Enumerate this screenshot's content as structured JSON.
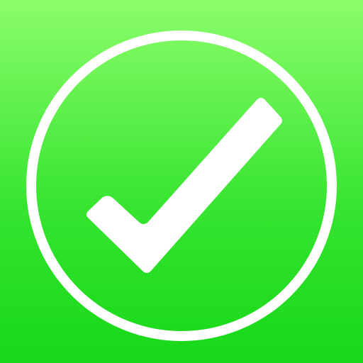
{
  "icon": {
    "name": "checkmark-app-icon",
    "glyph": "checkmark-icon",
    "colors": {
      "background_top": "#8bfd6b",
      "background_bottom": "#17d818",
      "foreground": "#ffffff"
    }
  }
}
